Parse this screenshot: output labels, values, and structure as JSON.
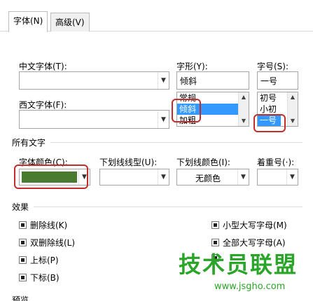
{
  "tabs": [
    {
      "label": "字体(N)"
    },
    {
      "label": "高级(V)"
    }
  ],
  "chinese_font": {
    "label": "中文字体(T):",
    "value": ""
  },
  "western_font": {
    "label": "西文字体(F):",
    "value": ""
  },
  "font_style": {
    "label": "字形(Y):",
    "value": "倾斜",
    "options": [
      "常规",
      "倾斜",
      "加粗"
    ],
    "selected": "倾斜"
  },
  "font_size": {
    "label": "字号(S):",
    "value": "一号",
    "options": [
      "初号",
      "小初",
      "一号"
    ],
    "selected": "一号"
  },
  "all_text": {
    "section": "所有文字",
    "font_color": {
      "label": "字体颜色(C):",
      "swatch": "#4a7a30"
    },
    "underline_style": {
      "label": "下划线线型(U):",
      "value": ""
    },
    "underline_color": {
      "label": "下划线颜色(I):",
      "value": "无颜色"
    },
    "emphasis": {
      "label": "着重号(·):",
      "value": ""
    }
  },
  "effects": {
    "section": "效果",
    "items": [
      {
        "label": "删除线(K)"
      },
      {
        "label": "双删除线(L)"
      },
      {
        "label": "上标(P)"
      },
      {
        "label": "下标(B)"
      },
      {
        "label": "小型大写字母(M)"
      },
      {
        "label": "全部大写字母(A)"
      }
    ]
  },
  "preview": {
    "section": "预览"
  },
  "watermark": {
    "brand": "技术员联盟",
    "url": "www.jsgho.com"
  },
  "colors": {
    "accent": "#3399ff",
    "highlight": "#c42b2b",
    "watermark": "#2aa52a"
  }
}
